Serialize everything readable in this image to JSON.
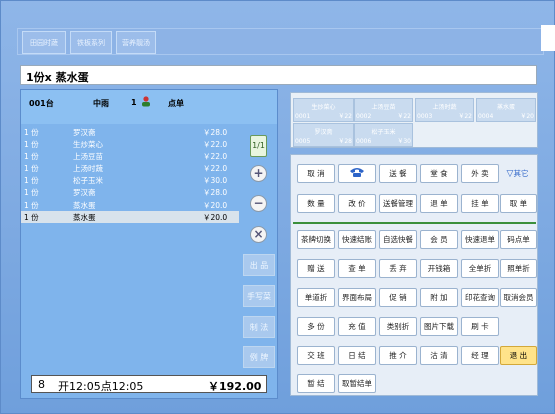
{
  "categories": [
    "田园时蔬",
    "铁板系列",
    "营养靓汤"
  ],
  "current_dish": "1份x 蒸水蛋",
  "order_header": {
    "table": "001台",
    "section": "中雨",
    "guests": "1",
    "label": "点单"
  },
  "order_lines": [
    {
      "qty": "1 份",
      "name": "罗汉斋",
      "price": "￥28.0"
    },
    {
      "qty": "1 份",
      "name": "生炒菜心",
      "price": "￥22.0"
    },
    {
      "qty": "1 份",
      "name": "上汤豆苗",
      "price": "￥22.0"
    },
    {
      "qty": "1 份",
      "name": "上汤时蔬",
      "price": "￥22.0"
    },
    {
      "qty": "1 份",
      "name": "松子玉米",
      "price": "￥30.0"
    },
    {
      "qty": "1 份",
      "name": "罗汉斋",
      "price": "￥28.0"
    },
    {
      "qty": "1 份",
      "name": "蒸水蛋",
      "price": "￥20.0"
    },
    {
      "qty": "1 份",
      "name": "蒸水蛋",
      "price": "￥20.0"
    }
  ],
  "page_indicator": "1/1",
  "side_buttons": {
    "plus": "+",
    "minus": "−",
    "remove": "×",
    "serve": "出 品",
    "handwrite": "手写菜",
    "method": "制 法",
    "example": "例 牌"
  },
  "total": {
    "count": "8",
    "time": "开12:05点12:05",
    "amount": "￥192.00"
  },
  "set_menu": [
    {
      "name": "生炒菜心",
      "code": "0001",
      "price": "￥22"
    },
    {
      "name": "上汤豆苗",
      "code": "0002",
      "price": "￥22"
    },
    {
      "name": "上汤时蔬",
      "code": "0003",
      "price": "￥22"
    },
    {
      "name": "蒸水蛋",
      "code": "0004",
      "price": "￥20"
    },
    {
      "name": "罗汉斋",
      "code": "0005",
      "price": "￥28"
    },
    {
      "name": "松子玉米",
      "code": "0006",
      "price": "￥30"
    }
  ],
  "buttons": {
    "cancel": "取 消",
    "deliver": "送 餐",
    "dine": "堂 食",
    "takeout": "外 卖",
    "other": "其它",
    "qty": "数 量",
    "edit_price": "改 价",
    "deliver_mgmt": "送餐管理",
    "refund": "退 单",
    "hold": "挂 单",
    "pick": "取 单",
    "switch_cafe": "茶牌切换",
    "quick_checkout": "快速结账",
    "self_select": "自选快餐",
    "member": "会 员",
    "quick_refund": "快速退单",
    "points": "码点单",
    "gift": "赠 送",
    "query": "查 单",
    "discard": "丢 弃",
    "open_cashbox": "开钱箱",
    "full_discount": "全单折",
    "receipt_discount": "照单折",
    "single_discount": "单道折",
    "ui_layout": "界面布局",
    "promo": "促 销",
    "add": "附 加",
    "print_query": "印花查询",
    "cancel_member": "取消会员",
    "multi": "多 份",
    "recharge": "充 值",
    "cat_discount": "类别折",
    "img_download": "图片下载",
    "swipe": "刷 卡",
    "shift": "交 班",
    "daily": "日 结",
    "recommend": "推 介",
    "clear": "沽 清",
    "manager": "经 理",
    "exit": "退 出",
    "temp_settle": "暂 结",
    "cancel_settle": "取暂结单"
  },
  "colors": {
    "panel": "#7fb4ec",
    "exit": "#ffe38a",
    "accent_line": "#3b8f3b"
  }
}
